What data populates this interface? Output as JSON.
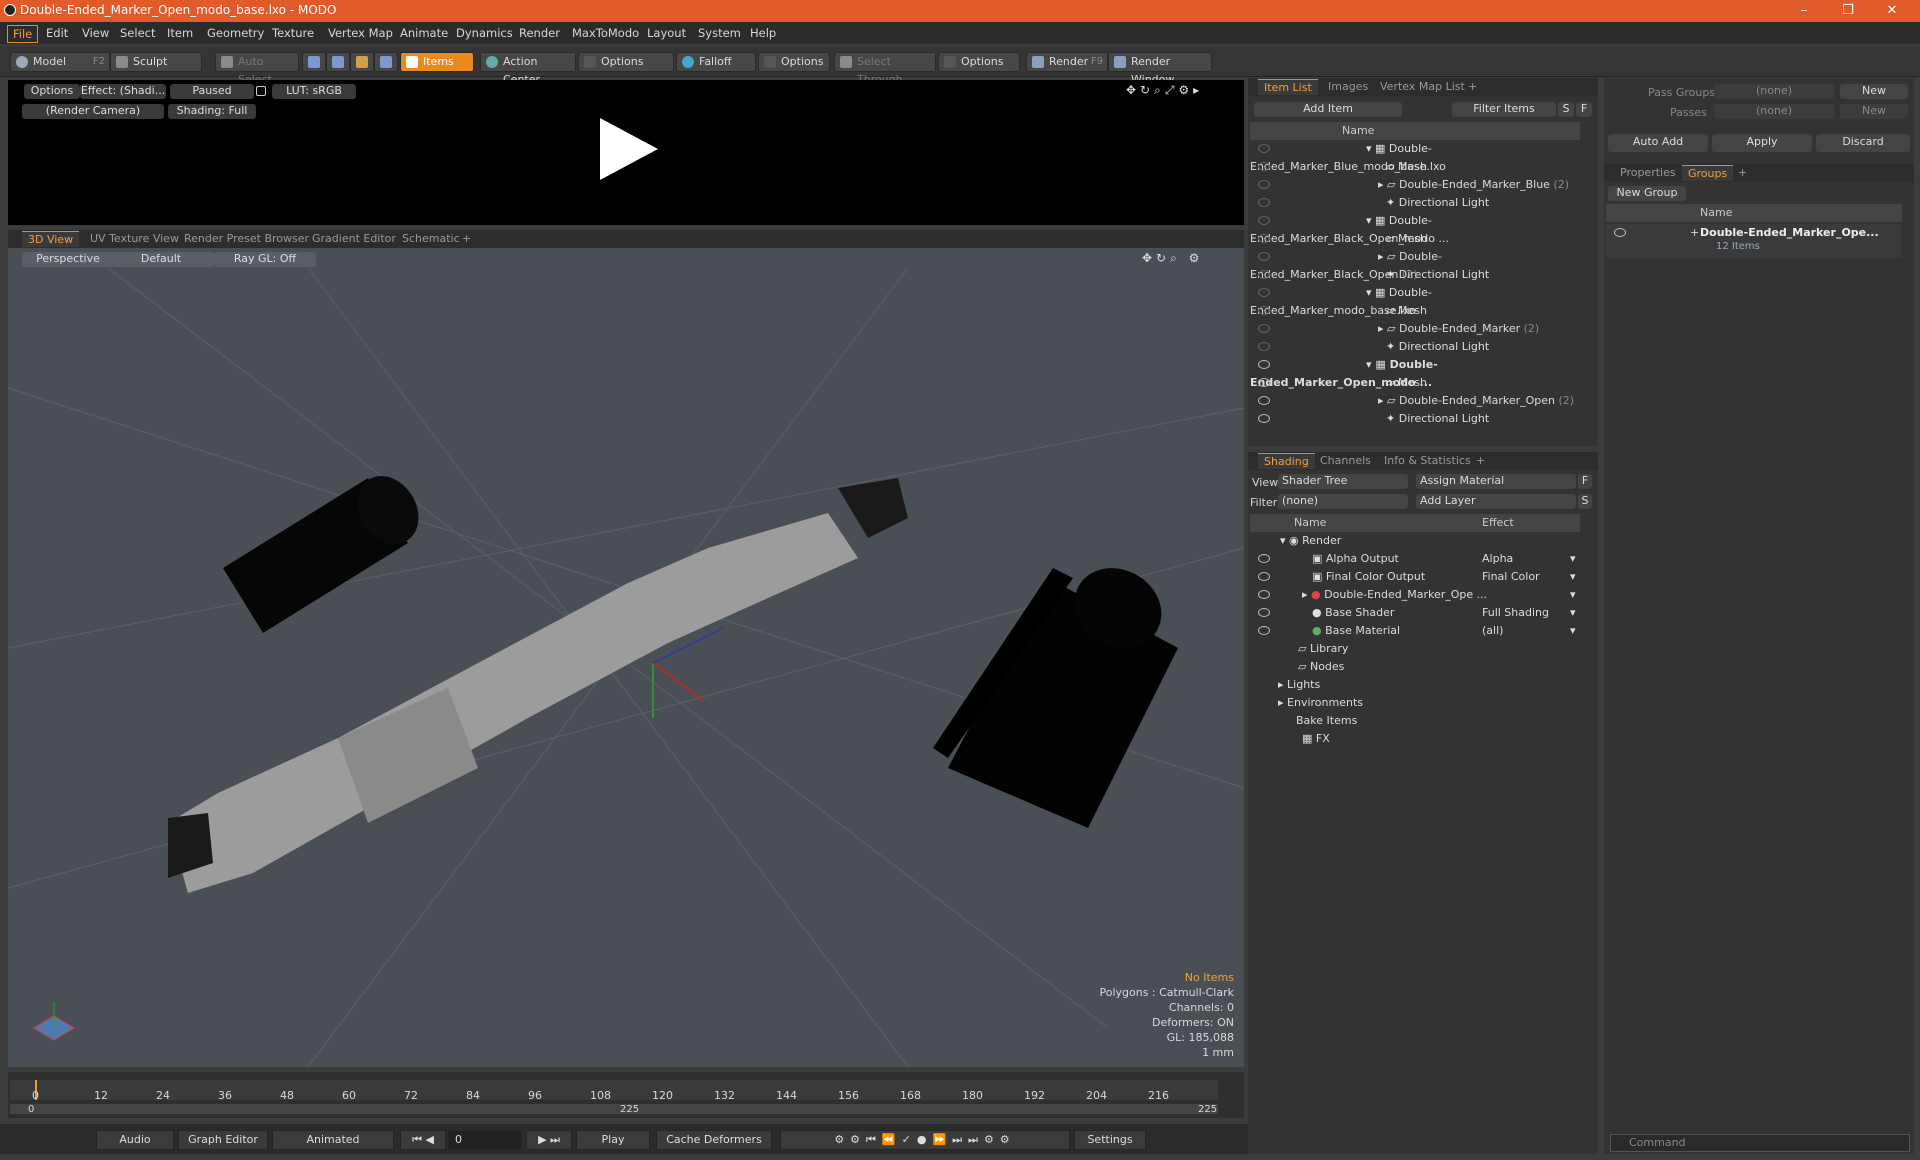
{
  "window": {
    "title": "Double-Ended_Marker_Open_modo_base.lxo - MODO",
    "min": "–",
    "max": "❐",
    "close": "✕"
  },
  "menu": [
    "File",
    "Edit",
    "View",
    "Select",
    "Item",
    "Geometry",
    "Texture",
    "Vertex Map",
    "Animate",
    "Dynamics",
    "Render",
    "MaxToModo",
    "Layout",
    "System",
    "Help"
  ],
  "toolbar": {
    "model": "Model",
    "model_key": "F2",
    "sculpt": "Sculpt",
    "auto_select": "Auto Select",
    "items": "Items",
    "action_center": "Action Center",
    "options1": "Options",
    "falloff": "Falloff",
    "options2": "Options",
    "select_through": "Select Through",
    "options3": "Options",
    "render": "Render",
    "render_key": "F9",
    "render_window": "Render Window"
  },
  "preview": {
    "options": "Options",
    "effect": "Effect: (Shadi...",
    "paused": "Paused",
    "lut": "LUT: sRGB",
    "camera": "(Render Camera)",
    "shading": "Shading: Full"
  },
  "viewport_tabs": [
    "3D View",
    "UV Texture View",
    "Render Preset Browser",
    "Gradient Editor",
    "Schematic",
    "+"
  ],
  "viewport": {
    "perspective": "Perspective",
    "default": "Default",
    "raygl": "Ray GL: Off",
    "info": {
      "no_items": "No Items",
      "polygons": "Polygons : Catmull-Clark",
      "channels": "Channels: 0",
      "deformers": "Deformers: ON",
      "gl": "GL: 185,088",
      "unit": "1 mm"
    }
  },
  "timeline": {
    "ticks": [
      "0",
      "12",
      "24",
      "36",
      "48",
      "60",
      "72",
      "84",
      "96",
      "108",
      "120",
      "132",
      "144",
      "156",
      "168",
      "180",
      "192",
      "204",
      "216"
    ],
    "start": "0",
    "mid": "225",
    "end": "225"
  },
  "bottombar": {
    "audio": "Audio",
    "graph_editor": "Graph Editor",
    "animated": "Animated",
    "frame": "0",
    "play": "Play",
    "cache": "Cache Deformers",
    "settings": "Settings"
  },
  "item_list": {
    "tabs": [
      "Item List",
      "Images",
      "Vertex Map List",
      "+"
    ],
    "add_item": "Add Item",
    "filter": "Filter Items",
    "s": "S",
    "f": "F",
    "name_col": "Name",
    "rows": [
      {
        "label": "Double-Ended_Marker_Blue_modo_base.lxo",
        "indent": 0,
        "type": "scene",
        "bold": false
      },
      {
        "label": "Mesh",
        "indent": 1,
        "type": "mesh",
        "bold": false
      },
      {
        "label": "Double-Ended_Marker_Blue",
        "count": "(2)",
        "indent": 1,
        "type": "group",
        "bold": false
      },
      {
        "label": "Directional Light",
        "indent": 1,
        "type": "light",
        "bold": false
      },
      {
        "label": "Double-Ended_Marker_Black_Open_modo ...",
        "indent": 0,
        "type": "scene",
        "bold": false
      },
      {
        "label": "Mesh",
        "indent": 1,
        "type": "mesh",
        "bold": false
      },
      {
        "label": "Double-Ended_Marker_Black_Open",
        "count": "(2)",
        "indent": 1,
        "type": "group",
        "bold": false
      },
      {
        "label": "Directional Light",
        "indent": 1,
        "type": "light",
        "bold": false
      },
      {
        "label": "Double-Ended_Marker_modo_base.lxo",
        "indent": 0,
        "type": "scene",
        "bold": false
      },
      {
        "label": "Mesh",
        "indent": 1,
        "type": "mesh",
        "bold": false
      },
      {
        "label": "Double-Ended_Marker",
        "count": "(2)",
        "indent": 1,
        "type": "group",
        "bold": false
      },
      {
        "label": "Directional Light",
        "indent": 1,
        "type": "light",
        "bold": false
      },
      {
        "label": "Double-Ended_Marker_Open_modo ...",
        "indent": 0,
        "type": "scene",
        "bold": true
      },
      {
        "label": "Mesh",
        "indent": 1,
        "type": "mesh",
        "bold": false
      },
      {
        "label": "Double-Ended_Marker_Open",
        "count": "(2)",
        "indent": 1,
        "type": "group",
        "bold": false
      },
      {
        "label": "Directional Light",
        "indent": 1,
        "type": "light",
        "bold": false
      }
    ]
  },
  "shading": {
    "tabs": [
      "Shading",
      "Channels",
      "Info & Statistics",
      "+"
    ],
    "view_label": "View",
    "view_value": "Shader Tree",
    "assign": "Assign Material",
    "f": "F",
    "filter_label": "Filter",
    "filter_value": "(none)",
    "add_layer": "Add Layer",
    "s": "S",
    "name_col": "Name",
    "effect_col": "Effect",
    "rows": [
      {
        "label": "Render",
        "effect": "",
        "indent": 0
      },
      {
        "label": "Alpha Output",
        "effect": "Alpha",
        "indent": 1
      },
      {
        "label": "Final Color Output",
        "effect": "Final Color",
        "indent": 1
      },
      {
        "label": "Double-Ended_Marker_Ope ...",
        "effect": "",
        "indent": 1
      },
      {
        "label": "Base Shader",
        "effect": "Full Shading",
        "indent": 1
      },
      {
        "label": "Base Material",
        "effect": "(all)",
        "indent": 1
      },
      {
        "label": "Library",
        "effect": "",
        "indent": 1
      },
      {
        "label": "Nodes",
        "effect": "",
        "indent": 1
      },
      {
        "label": "Lights",
        "effect": "",
        "indent": 0
      },
      {
        "label": "Environments",
        "effect": "",
        "indent": 0
      },
      {
        "label": "Bake Items",
        "effect": "",
        "indent": 0
      },
      {
        "label": "FX",
        "effect": "",
        "indent": 1
      }
    ]
  },
  "groups_panel": {
    "pass_groups": "Pass Groups",
    "passes": "Passes",
    "none": "(none)",
    "new": "New",
    "auto_add": "Auto Add",
    "apply": "Apply",
    "discard": "Discard",
    "tabs": [
      "Properties",
      "Groups",
      "+"
    ],
    "new_group": "New Group",
    "name_col": "Name",
    "group_name": "Double-Ended_Marker_Ope...",
    "group_count": "12 Items",
    "command": "Command"
  }
}
